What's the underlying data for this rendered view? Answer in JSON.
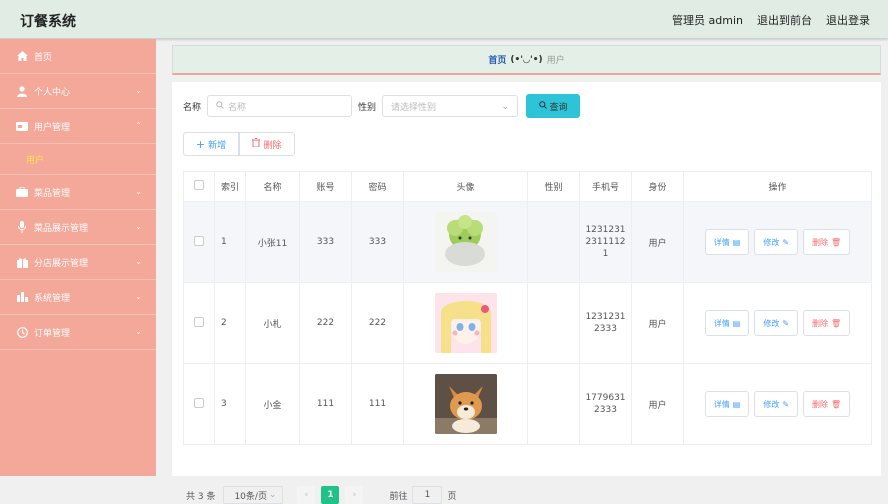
{
  "header": {
    "title": "订餐系统",
    "user": "管理员 admin",
    "to_front": "退出到前台",
    "logout": "退出登录"
  },
  "sidebar": {
    "items": [
      {
        "label": "首页",
        "icon": "home-icon",
        "chevron": false
      },
      {
        "label": "个人中心",
        "icon": "user-icon",
        "chevron": true
      },
      {
        "label": "用户管理",
        "icon": "card-icon",
        "chevron": true,
        "expanded": true
      },
      {
        "label": "菜品管理",
        "icon": "briefcase-icon",
        "chevron": true
      },
      {
        "label": "菜品展示管理",
        "icon": "mic-icon",
        "chevron": true
      },
      {
        "label": "分店展示管理",
        "icon": "gift-icon",
        "chevron": true
      },
      {
        "label": "系统管理",
        "icon": "chart-icon",
        "chevron": true
      },
      {
        "label": "订单管理",
        "icon": "clock-icon",
        "chevron": true
      }
    ],
    "sub_active": "用户"
  },
  "breadcrumb": {
    "home": "首页",
    "face": "(•'◡'•)",
    "current": "用户"
  },
  "search": {
    "name_label": "名称",
    "name_placeholder": "名称",
    "gender_label": "性别",
    "gender_placeholder": "请选择性别",
    "query_button": "查询"
  },
  "actions": {
    "add": "新增",
    "delete": "删除"
  },
  "table": {
    "columns": [
      "索引",
      "名称",
      "账号",
      "密码",
      "头像",
      "性别",
      "手机号",
      "身份",
      "操作"
    ],
    "rows": [
      {
        "index": "1",
        "name": "小张11",
        "account": "333",
        "password": "333",
        "avatar": "cabbage-doll",
        "gender": "",
        "phone": [
          "1231231",
          "2311112",
          "1"
        ],
        "role": "用户"
      },
      {
        "index": "2",
        "name": "小札",
        "account": "222",
        "password": "222",
        "avatar": "anime-girl",
        "gender": "",
        "phone": [
          "1231231",
          "2333"
        ],
        "role": "用户"
      },
      {
        "index": "3",
        "name": "小金",
        "account": "111",
        "password": "111",
        "avatar": "shiba-dog",
        "gender": "",
        "phone": [
          "1779631",
          "2333"
        ],
        "role": "用户"
      }
    ],
    "ops": {
      "detail": "详情",
      "edit": "修改",
      "remove": "删除"
    }
  },
  "pagination": {
    "total": "共 3 条",
    "page_size": "10条/页",
    "current": "1",
    "goto_prefix": "前往",
    "goto_value": "1",
    "goto_suffix": "页"
  },
  "colors": {
    "sidebar": "#f4a899",
    "topbar": "#e0ece4",
    "query": "#2ec4d8",
    "page_active": "#1fc287"
  }
}
